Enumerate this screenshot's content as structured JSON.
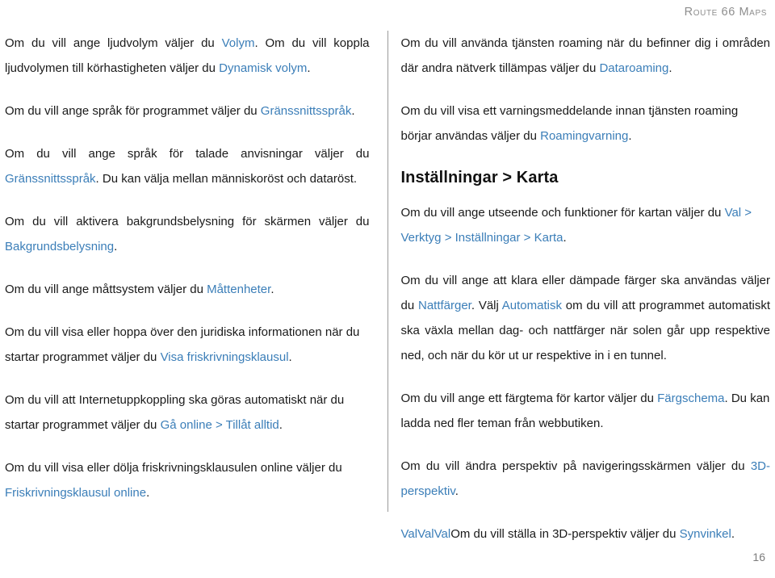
{
  "header": {
    "title": "Route 66 Maps"
  },
  "footer": {
    "page_number": "16"
  },
  "colors": {
    "link": "#3b7eb8",
    "text": "#1a1a1a",
    "header_gray": "#8e8e8e",
    "divider": "#9a9a9a"
  },
  "left_column": {
    "paragraphs": [
      {
        "runs": [
          {
            "text": "Om du vill ange ljudvolym väljer du ",
            "link": false
          },
          {
            "text": "Volym",
            "link": true
          },
          {
            "text": ". Om du vill koppla ljudvolymen till körhastigheten väljer du ",
            "link": false
          },
          {
            "text": "Dynamisk volym",
            "link": true
          },
          {
            "text": ".",
            "link": false
          }
        ],
        "align": "justify"
      },
      {
        "runs": [
          {
            "text": "Om du vill ange språk för programmet väljer du ",
            "link": false
          },
          {
            "text": "Gränssnittsspråk",
            "link": true
          },
          {
            "text": ".",
            "link": false
          }
        ],
        "align": "justify"
      },
      {
        "runs": [
          {
            "text": "Om du vill ange språk för talade anvisningar väljer du ",
            "link": false
          },
          {
            "text": "Gränssnittsspråk",
            "link": true
          },
          {
            "text": ". Du kan välja mellan människoröst och dataröst.",
            "link": false
          }
        ],
        "align": "justify"
      },
      {
        "runs": [
          {
            "text": "Om du vill aktivera bakgrundsbelysning för skärmen väljer du ",
            "link": false
          },
          {
            "text": "Bakgrundsbelysning",
            "link": true
          },
          {
            "text": ".",
            "link": false
          }
        ],
        "align": "justify"
      },
      {
        "runs": [
          {
            "text": "Om du vill ange måttsystem väljer du ",
            "link": false
          },
          {
            "text": "Måttenheter",
            "link": true
          },
          {
            "text": ".",
            "link": false
          }
        ],
        "align": "left"
      },
      {
        "runs": [
          {
            "text": "Om du vill visa eller hoppa över den juridiska informationen när du startar programmet väljer du ",
            "link": false
          },
          {
            "text": "Visa friskrivningsklausul",
            "link": true
          },
          {
            "text": ".",
            "link": false
          }
        ],
        "align": "left"
      },
      {
        "runs": [
          {
            "text": "Om du vill att Internetuppkoppling ska göras automatiskt när du startar programmet väljer du ",
            "link": false
          },
          {
            "text": "Gå online > Tillåt alltid",
            "link": true
          },
          {
            "text": ".",
            "link": false
          }
        ],
        "align": "left"
      },
      {
        "runs": [
          {
            "text": "Om du vill visa eller dölja friskrivningsklausulen online väljer du ",
            "link": false
          },
          {
            "text": "Friskrivningsklausul online",
            "link": true
          },
          {
            "text": ".",
            "link": false
          }
        ],
        "align": "left"
      }
    ]
  },
  "right_column": {
    "intro_paragraphs": [
      {
        "runs": [
          {
            "text": "Om du vill använda tjänsten roaming när du befinner dig i områden där andra nätverk tillämpas väljer du ",
            "link": false
          },
          {
            "text": "Dataroaming",
            "link": true
          },
          {
            "text": ".",
            "link": false
          }
        ],
        "align": "justify"
      },
      {
        "runs": [
          {
            "text": "Om du vill visa ett varningsmeddelande innan tjänsten roaming börjar användas väljer du ",
            "link": false
          },
          {
            "text": "Roamingvarning",
            "link": true
          },
          {
            "text": ".",
            "link": false
          }
        ],
        "align": "left"
      }
    ],
    "heading": "Inställningar > Karta",
    "paragraphs": [
      {
        "runs": [
          {
            "text": "Om du vill ange utseende och funktioner för kartan väljer du ",
            "link": false
          },
          {
            "text": "Val > Verktyg > Inställningar > Karta",
            "link": true
          },
          {
            "text": ".",
            "link": false
          }
        ],
        "align": "left"
      },
      {
        "runs": [
          {
            "text": "Om du vill ange att klara eller dämpade färger ska användas väljer du ",
            "link": false
          },
          {
            "text": "Nattfärger",
            "link": true
          },
          {
            "text": ". Välj ",
            "link": false
          },
          {
            "text": "Automatisk",
            "link": true
          },
          {
            "text": " om du vill att programmet automatiskt ska växla mellan dag- och nattfärger när solen går upp respektive ned, och när du kör ut ur respektive in i en tunnel.",
            "link": false
          }
        ],
        "align": "justify"
      },
      {
        "runs": [
          {
            "text": "Om du vill ange ett färgtema för kartor väljer du ",
            "link": false
          },
          {
            "text": "Färgschema",
            "link": true
          },
          {
            "text": ". Du kan ladda ned fler teman från webbutiken.",
            "link": false
          }
        ],
        "align": "left"
      },
      {
        "runs": [
          {
            "text": "Om du vill ändra perspektiv på navigeringsskärmen väljer du ",
            "link": false
          },
          {
            "text": "3D-perspektiv",
            "link": true
          },
          {
            "text": ".",
            "link": false
          }
        ],
        "align": "justify"
      },
      {
        "runs": [
          {
            "text": "ValValVal",
            "link": true
          },
          {
            "text": "Om du vill ställa in 3D-perspektiv väljer du ",
            "link": false
          },
          {
            "text": "Synvinkel",
            "link": true
          },
          {
            "text": ".",
            "link": false
          }
        ],
        "align": "left"
      }
    ]
  }
}
